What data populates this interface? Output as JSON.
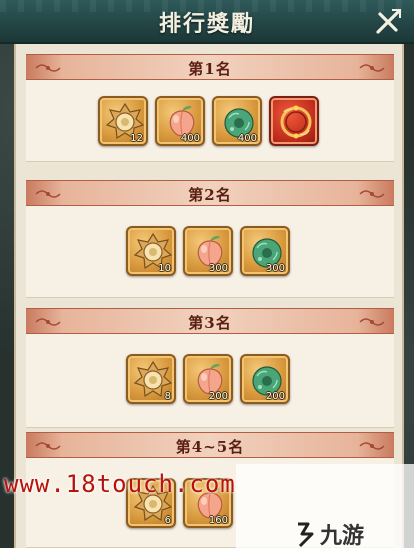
{
  "window": {
    "title": "排行獎勵"
  },
  "ranks": [
    {
      "label": "第1名",
      "items": [
        {
          "icon": "gold-medallion-icon",
          "count": "12",
          "style": "gold"
        },
        {
          "icon": "peach-icon",
          "count": "400",
          "style": "gold"
        },
        {
          "icon": "jade-pendant-icon",
          "count": "400",
          "style": "gold"
        },
        {
          "icon": "red-ring-frame-icon",
          "count": "",
          "style": "red"
        }
      ]
    },
    {
      "label": "第2名",
      "items": [
        {
          "icon": "gold-medallion-icon",
          "count": "10",
          "style": "gold"
        },
        {
          "icon": "peach-icon",
          "count": "300",
          "style": "gold"
        },
        {
          "icon": "jade-pendant-icon",
          "count": "300",
          "style": "gold"
        }
      ]
    },
    {
      "label": "第3名",
      "items": [
        {
          "icon": "gold-medallion-icon",
          "count": "8",
          "style": "gold"
        },
        {
          "icon": "peach-icon",
          "count": "200",
          "style": "gold"
        },
        {
          "icon": "jade-pendant-icon",
          "count": "200",
          "style": "gold"
        }
      ]
    },
    {
      "label": "第4~5名",
      "items": [
        {
          "icon": "gold-medallion-icon",
          "count": "6",
          "style": "gold"
        },
        {
          "icon": "peach-icon",
          "count": "160",
          "style": "gold"
        }
      ]
    }
  ],
  "watermark": {
    "left_text": "www.18touch.com",
    "right_text": "九游"
  },
  "colors": {
    "header_red": "#c97a5e",
    "panel": "#ece4d4",
    "title_bar": "#244646"
  }
}
